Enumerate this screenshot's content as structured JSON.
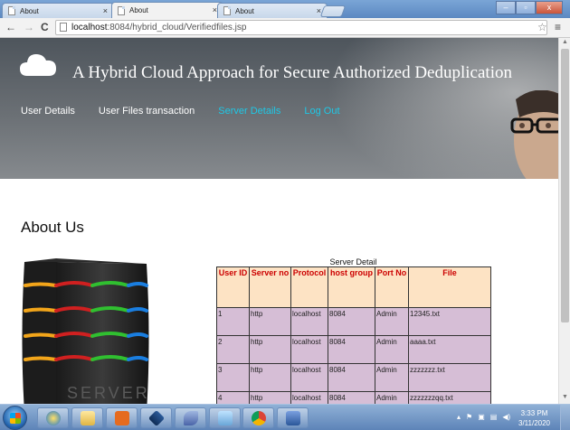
{
  "browser": {
    "tabs": [
      {
        "label": "About",
        "close": "×"
      },
      {
        "label": "About",
        "close": "×"
      },
      {
        "label": "About",
        "close": "×"
      }
    ],
    "url_host": "localhost",
    "url_rest": ":8084/hybrid_cloud/Verifiedfiles.jsp",
    "back": "←",
    "forward": "→",
    "reload": "C",
    "star": "☆",
    "menu": "≡",
    "window_buttons": [
      "–",
      "▫",
      "x"
    ]
  },
  "site": {
    "title": "A Hybrid Cloud Approach for Secure Authorized Deduplication",
    "nav": [
      {
        "label": "User Details",
        "color": "#ffffff"
      },
      {
        "label": "User Files transaction",
        "color": "#ffffff"
      },
      {
        "label": "Server Details",
        "color": "#1ec8e6"
      },
      {
        "label": "Log Out",
        "color": "#1ec8e6"
      }
    ]
  },
  "page": {
    "heading": "About Us",
    "server_image_text": "SERVER"
  },
  "table": {
    "caption": "Server Detail",
    "headers": [
      "User ID",
      "Server no",
      "Protocol",
      "host group",
      "Port No",
      "File"
    ],
    "rows": [
      [
        "1",
        "http",
        "localhost",
        "8084",
        "Admin",
        "12345.txt"
      ],
      [
        "2",
        "http",
        "localhost",
        "8084",
        "Admin",
        "aaaa.txt"
      ],
      [
        "3",
        "http",
        "localhost",
        "8084",
        "Admin",
        "zzzzzzz.txt"
      ],
      [
        "4",
        "http",
        "localhost",
        "8084",
        "Admin",
        "zzzzzzzqq.txt"
      ]
    ]
  },
  "taskbar": {
    "time": "3:33 PM",
    "date": "3/11/2020",
    "tray_icons": [
      "▴",
      "⚑",
      "▣",
      "▤",
      "◀)"
    ]
  }
}
